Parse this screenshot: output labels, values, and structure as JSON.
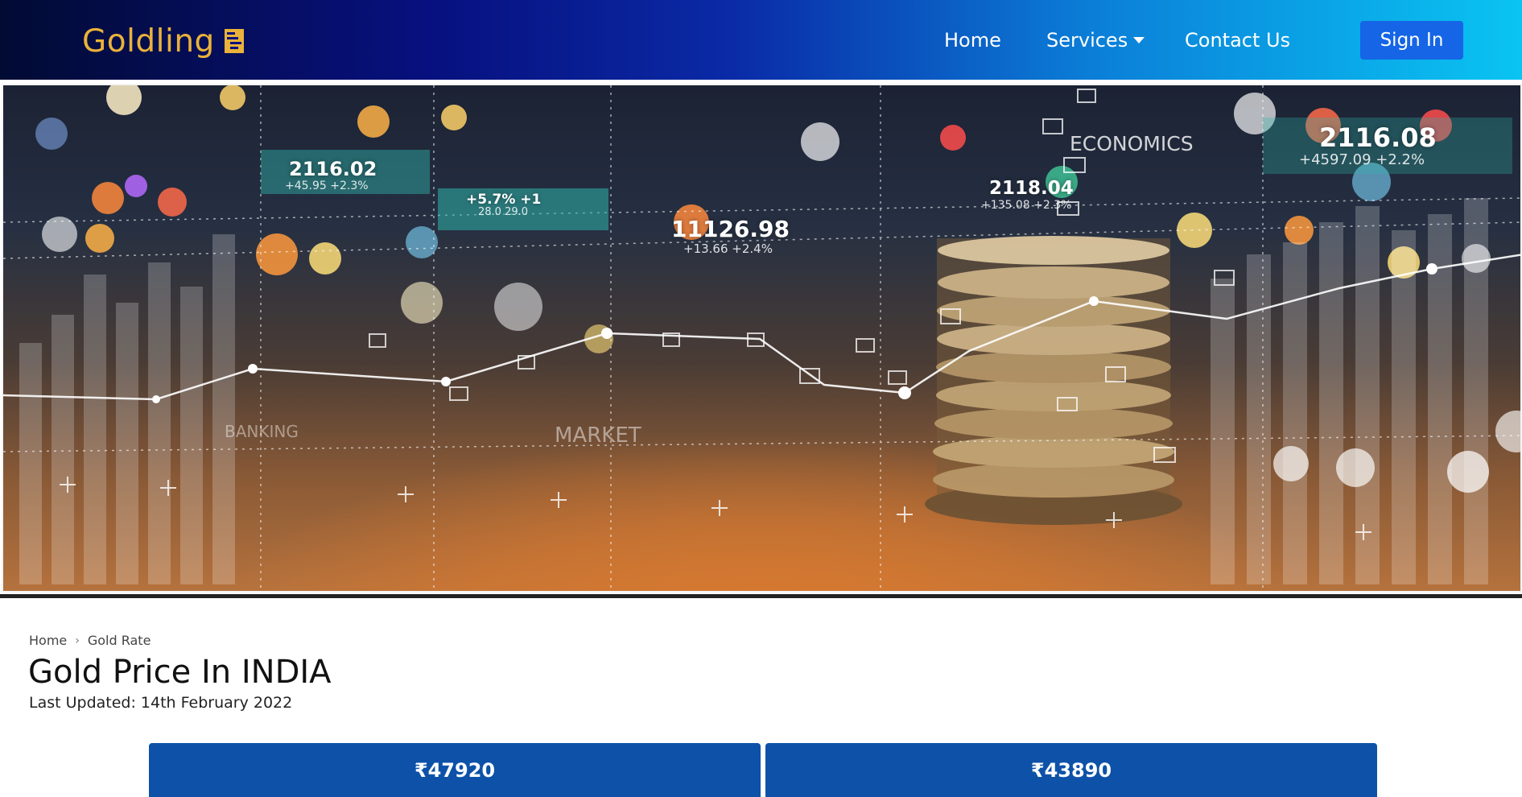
{
  "navbar": {
    "brand": "Goldling",
    "links": {
      "home": "Home",
      "services": "Services",
      "contact": "Contact Us"
    },
    "sign_in": "Sign In"
  },
  "hero": {
    "numbers": [
      {
        "value": "2116.02",
        "sub": "+45.95  +2.3%"
      },
      {
        "value": "+5.7%  +1",
        "sub": "28.0  29.0"
      },
      {
        "value": "11126.98",
        "sub": "+13.66  +2.4%"
      },
      {
        "value": "2118.04",
        "sub": "+135.08  +2.3%"
      },
      {
        "value": "2116.08",
        "sub": "+4597.09  +2.2%"
      }
    ],
    "words": {
      "economics": "ECONOMICS",
      "market": "MARKET",
      "banking": "BANKING"
    }
  },
  "breadcrumb": {
    "home": "Home",
    "current": "Gold Rate"
  },
  "page": {
    "title": "Gold Price In INDIA",
    "last_updated": "Last Updated: 14th February 2022"
  },
  "prices": {
    "card_1": "₹47920",
    "card_2": "₹43890"
  },
  "colors": {
    "brand": "#e9b23a",
    "sign_in_bg": "#1565e6",
    "price_card_bg": "#0d52a8"
  }
}
